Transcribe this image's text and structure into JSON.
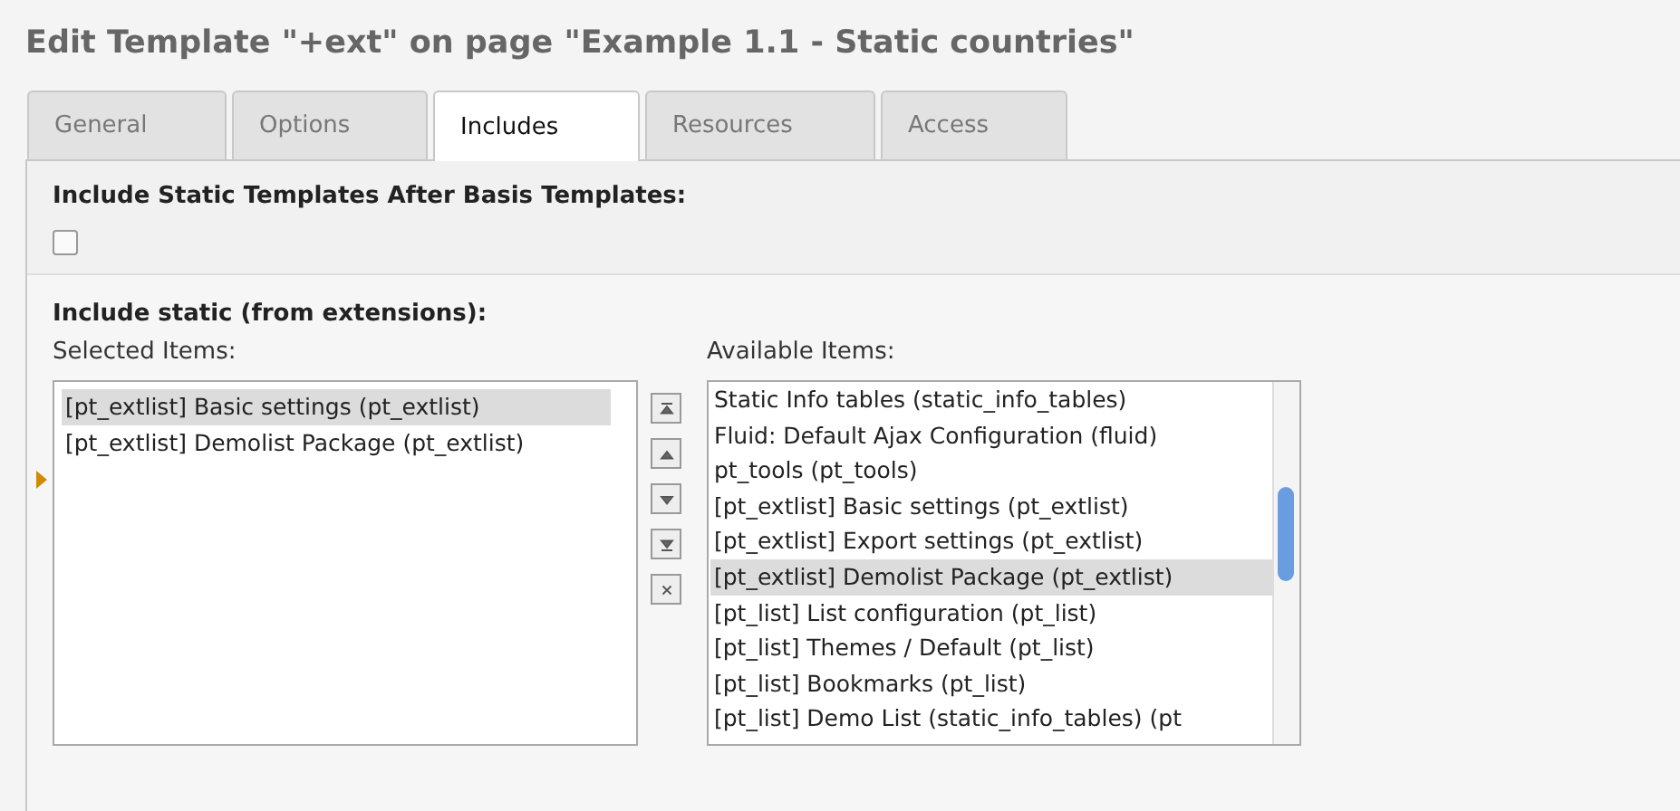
{
  "title": "Edit Template \"+ext\" on page \"Example 1.1 - Static countries\"",
  "tabs": [
    {
      "label": "General",
      "selected": false
    },
    {
      "label": "Options",
      "selected": false
    },
    {
      "label": "Includes",
      "selected": true
    },
    {
      "label": "Resources",
      "selected": false
    },
    {
      "label": "Access",
      "selected": false
    }
  ],
  "include_after_basis": {
    "label": "Include Static Templates After Basis Templates:",
    "checked": false
  },
  "include_static": {
    "label": "Include static (from extensions):",
    "selected_label": "Selected Items:",
    "selected_items": [
      {
        "text": "[pt_extlist] Basic settings (pt_extlist)",
        "selected": true
      },
      {
        "text": "[pt_extlist] Demolist Package (pt_extlist)",
        "selected": false
      }
    ],
    "buttons": [
      {
        "kind": "top"
      },
      {
        "kind": "up"
      },
      {
        "kind": "down"
      },
      {
        "kind": "bottom"
      },
      {
        "kind": "remove"
      }
    ],
    "available_label": "Available Items:",
    "available_items": [
      {
        "text": "Static Info tables (static_info_tables)",
        "selected": false
      },
      {
        "text": "Fluid: Default Ajax Configuration (fluid)",
        "selected": false
      },
      {
        "text": "pt_tools (pt_tools)",
        "selected": false
      },
      {
        "text": "[pt_extlist] Basic settings (pt_extlist)",
        "selected": false
      },
      {
        "text": "[pt_extlist] Export settings (pt_extlist)",
        "selected": false
      },
      {
        "text": "[pt_extlist] Demolist Package (pt_extlist)",
        "selected": true
      },
      {
        "text": "[pt_list] List configuration (pt_list)",
        "selected": false
      },
      {
        "text": "[pt_list] Themes / Default (pt_list)",
        "selected": false
      },
      {
        "text": "[pt_list] Bookmarks (pt_list)",
        "selected": false
      },
      {
        "text": "[pt_list] Demo List (static_info_tables) (pt",
        "selected": false
      }
    ]
  }
}
